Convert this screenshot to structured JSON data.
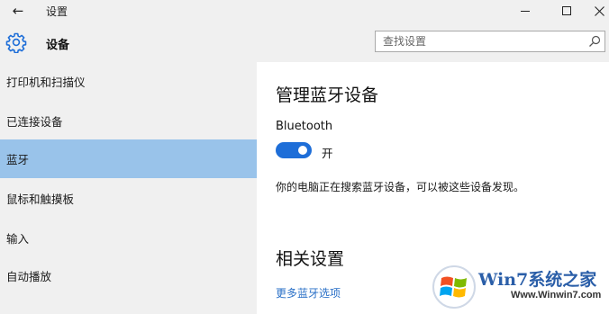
{
  "titlebar": {
    "back_label": "←",
    "title": "设置"
  },
  "header": {
    "title": "设备",
    "search_placeholder": "查找设置"
  },
  "sidebar": {
    "items": [
      {
        "label": "打印机和扫描仪"
      },
      {
        "label": "已连接设备"
      },
      {
        "label": "蓝牙",
        "selected": true
      },
      {
        "label": "鼠标和触摸板"
      },
      {
        "label": "输入"
      },
      {
        "label": "自动播放"
      }
    ]
  },
  "main": {
    "section_title": "管理蓝牙设备",
    "bluetooth_label": "Bluetooth",
    "toggle_state": "开",
    "toggle_on": true,
    "searching_text": "你的电脑正在搜索蓝牙设备，可以被这些设备发现。",
    "related_title": "相关设置",
    "more_link": "更多蓝牙选项"
  },
  "watermark": {
    "brand": "Win7系统之家",
    "url": "Www.Winwin7.com"
  },
  "colors": {
    "accent": "#1e6ed8",
    "selected_item": "#99c3ea",
    "link": "#2a70c7",
    "sidebar_bg": "#f0f0f0"
  }
}
